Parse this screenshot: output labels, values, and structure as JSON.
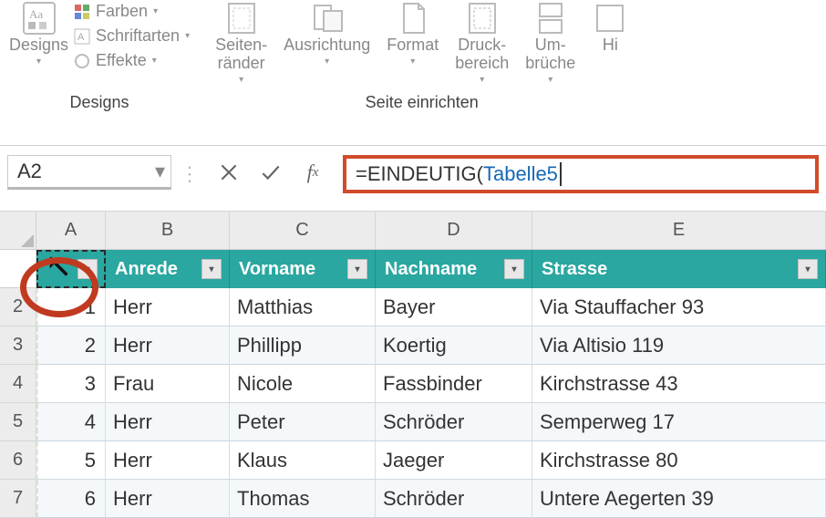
{
  "ribbon": {
    "designs_group": {
      "label": "Designs",
      "designs_btn": "Designs",
      "farben": "Farben",
      "schriftarten": "Schriftarten",
      "effekte": "Effekte"
    },
    "page_setup_group": {
      "label": "Seite einrichten",
      "seitenraender": "Seiten-\nränder",
      "ausrichtung": "Ausrichtung",
      "format": "Format",
      "druckbereich": "Druck-\nbereich",
      "umbrueche": "Um-\nbrüche",
      "hintergrund": "Hi"
    }
  },
  "formula_bar": {
    "name_box": "A2",
    "formula_prefix": "=EINDEUTIG(",
    "formula_ref": "Tabelle5"
  },
  "grid": {
    "col_letters": [
      "A",
      "B",
      "C",
      "D",
      "E"
    ],
    "row_numbers": [
      "2",
      "3",
      "4",
      "5",
      "6",
      "7"
    ],
    "headers": {
      "id": "",
      "anrede": "Anrede",
      "vorname": "Vorname",
      "nachname": "Nachname",
      "strasse": "Strasse"
    },
    "rows": [
      {
        "n": "1",
        "anrede": "Herr",
        "vor": "Matthias",
        "nach": "Bayer",
        "str": "Via Stauffacher 93"
      },
      {
        "n": "2",
        "anrede": "Herr",
        "vor": "Phillipp",
        "nach": "Koertig",
        "str": "Via Altisio 119"
      },
      {
        "n": "3",
        "anrede": "Frau",
        "vor": "Nicole",
        "nach": "Fassbinder",
        "str": "Kirchstrasse 43"
      },
      {
        "n": "4",
        "anrede": "Herr",
        "vor": "Peter",
        "nach": "Schröder",
        "str": "Semperweg 17"
      },
      {
        "n": "5",
        "anrede": "Herr",
        "vor": "Klaus",
        "nach": "Jaeger",
        "str": "Kirchstrasse 80"
      },
      {
        "n": "6",
        "anrede": "Herr",
        "vor": "Thomas",
        "nach": "Schröder",
        "str": "Untere Aegerten 39"
      }
    ]
  }
}
